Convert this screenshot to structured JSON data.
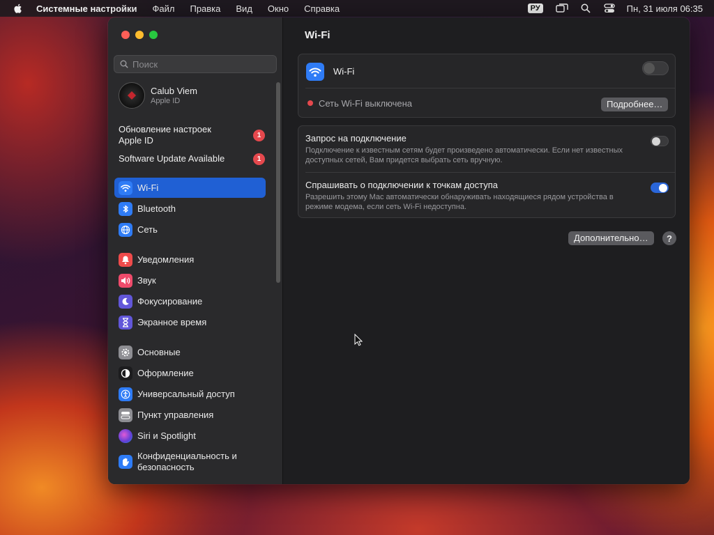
{
  "menubar": {
    "app_name": "Системные настройки",
    "items": [
      "Файл",
      "Правка",
      "Вид",
      "Окно",
      "Справка"
    ],
    "input_source": "РУ",
    "clock": "Пн, 31 июля  06:35",
    "icons": [
      "apple-logo-icon",
      "screen-mirroring-icon",
      "spotlight-search-icon",
      "control-center-icon"
    ]
  },
  "window": {
    "sidebar": {
      "search_placeholder": "Поиск",
      "profile": {
        "name": "Calub Viem",
        "subtitle": "Apple ID"
      },
      "notifications": [
        {
          "label": "Обновление настроек Apple ID",
          "badge": "1"
        },
        {
          "label": "Software Update Available",
          "badge": "1"
        }
      ],
      "items": [
        {
          "label": "Wi-Fi",
          "icon": "wifi-icon",
          "color": "#2f7cf6",
          "active": true
        },
        {
          "label": "Bluetooth",
          "icon": "bluetooth-icon",
          "color": "#2f7cf6"
        },
        {
          "label": "Сеть",
          "icon": "globe-icon",
          "color": "#2f7cf6"
        },
        {
          "label": "Уведомления",
          "icon": "bell-icon",
          "color": "#ef4b4b"
        },
        {
          "label": "Звук",
          "icon": "speaker-icon",
          "color": "#ef4b6b"
        },
        {
          "label": "Фокусирование",
          "icon": "moon-icon",
          "color": "#6257d9"
        },
        {
          "label": "Экранное время",
          "icon": "hourglass-icon",
          "color": "#6257d9"
        },
        {
          "label": "Основные",
          "icon": "gear-icon",
          "color": "#8e8e93"
        },
        {
          "label": "Оформление",
          "icon": "appearance-icon",
          "color": "#1c1c1e"
        },
        {
          "label": "Универсальный доступ",
          "icon": "accessibility-icon",
          "color": "#2f7cf6"
        },
        {
          "label": "Пункт управления",
          "icon": "control-center-icon",
          "color": "#8e8e93"
        },
        {
          "label": "Siri и Spotlight",
          "icon": "siri-icon",
          "color": "#b04fd6"
        },
        {
          "label": "Конфиденциальность и безопасность",
          "icon": "hand-icon",
          "color": "#2f7cf6"
        }
      ]
    },
    "content": {
      "title": "Wi-Fi",
      "wifi_card": {
        "label": "Wi-Fi",
        "enabled": false,
        "status": "Сеть Wi-Fi выключена",
        "status_color": "#e5484d",
        "details_button": "Подробнее…"
      },
      "options": [
        {
          "title": "Запрос на подключение",
          "description": "Подключение к известным сетям будет произведено автоматически. Если нет известных доступных сетей, Вам придется выбрать сеть вручную.",
          "enabled": false
        },
        {
          "title": "Спрашивать о подключении к точкам доступа",
          "description": "Разрешить этому Mac автоматически обнаруживать находящиеся рядом устройства в режиме модема, если сеть Wi-Fi недоступна.",
          "enabled": true
        }
      ],
      "advanced_button": "Дополнительно…",
      "help_button": "?"
    }
  }
}
